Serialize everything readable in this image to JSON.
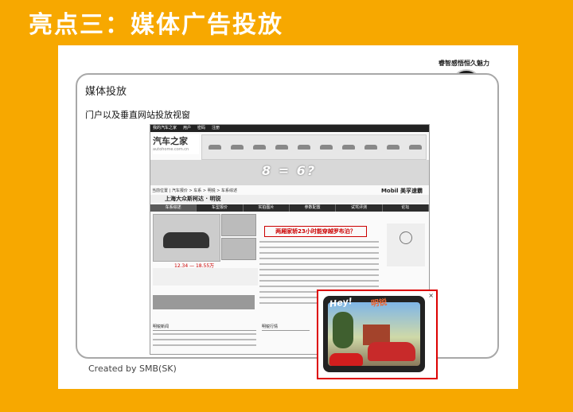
{
  "headline": "亮点三：媒体广告投放",
  "tagline": "睿智感悟恒久魅力",
  "frame_title": "媒体投放",
  "subtitle": "门户以及垂直网站投放视窗",
  "site": {
    "topbar_items": [
      "我的汽车之家",
      "用户",
      "密码",
      "注册"
    ],
    "logo_name": "汽车之家",
    "logo_url": "autohome.com.cn",
    "banner_text": "8 = 6?",
    "breadcrumb": "当前位置 | 汽车报价 > 车系 > 明锐 > 车系综述",
    "mobil": "Mobil 美孚速霸",
    "model_title": "上海大众斯柯达 · 明锐",
    "tabs": [
      "车系综述",
      "车型报价",
      "实拍图片",
      "参数配置",
      "试驾评测",
      "论坛"
    ],
    "price": "12.34 — 18.55万",
    "headline_news": "两厢家轿23小时能穿越罗布泊？",
    "section_left": "明锐新闻",
    "section_right": "明锐行情"
  },
  "popup": {
    "close": "×",
    "hey": "Hey!",
    "brand": "明锐"
  },
  "credit": "Created by SMB(SK)",
  "colors": {
    "background": "#f7a800",
    "accent": "#d00000"
  }
}
